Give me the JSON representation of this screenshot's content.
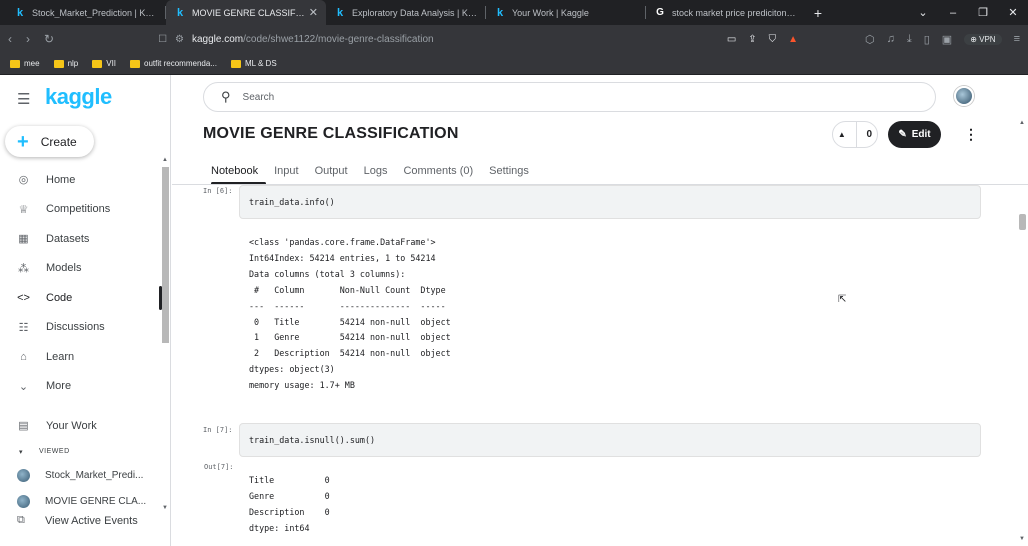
{
  "browser": {
    "tabs": [
      {
        "label": "Stock_Market_Prediction | Kaggle",
        "icon": "kaggle-icon",
        "active": false
      },
      {
        "label": "MOVIE GENRE CLASSIFICATION",
        "icon": "kaggle-icon",
        "active": true
      },
      {
        "label": "Exploratory Data Analysis | Kaggle",
        "icon": "kaggle-icon",
        "active": false
      },
      {
        "label": "Your Work | Kaggle",
        "icon": "kaggle-icon",
        "active": false
      },
      {
        "label": "stock market price prediciton - Goo",
        "icon": "google-icon",
        "active": false
      }
    ],
    "url_host": "kaggle.com",
    "url_path": "/code/shwe1122/movie-genre-classification",
    "vpn_label": "VPN",
    "bookmarks": [
      "mee",
      "nlp",
      "VII",
      "outfit recommenda...",
      "ML & DS"
    ]
  },
  "sidebar": {
    "logo": "kaggle",
    "create_label": "Create",
    "items": [
      {
        "label": "Home",
        "icon": "compass-icon"
      },
      {
        "label": "Competitions",
        "icon": "trophy-icon"
      },
      {
        "label": "Datasets",
        "icon": "table-icon"
      },
      {
        "label": "Models",
        "icon": "models-icon"
      },
      {
        "label": "Code",
        "icon": "code-icon"
      },
      {
        "label": "Discussions",
        "icon": "discussions-icon"
      },
      {
        "label": "Learn",
        "icon": "learn-icon"
      },
      {
        "label": "More",
        "icon": "chevron-down-icon"
      }
    ],
    "your_work_label": "Your Work",
    "viewed_label": "VIEWED",
    "viewed_items": [
      "Stock_Market_Predi...",
      "MOVIE GENRE CLA..."
    ],
    "view_active_events": "View Active Events"
  },
  "header": {
    "search_placeholder": "Search",
    "title": "MOVIE GENRE CLASSIFICATION",
    "vote_count": "0",
    "edit_label": "Edit",
    "tabs": [
      "Notebook",
      "Input",
      "Output",
      "Logs",
      "Comments (0)",
      "Settings"
    ]
  },
  "notebook": {
    "cell6_prompt": "In [6]:",
    "cell6_code": "train_data.info()",
    "cell6_output": "<class 'pandas.core.frame.DataFrame'>\nInt64Index: 54214 entries, 1 to 54214\nData columns (total 3 columns):\n #   Column       Non-Null Count  Dtype \n---  ------       --------------  ----- \n 0   Title        54214 non-null  object\n 1   Genre        54214 non-null  object\n 2   Description  54214 non-null  object\ndtypes: object(3)\nmemory usage: 1.7+ MB",
    "cell7_prompt": "In [7]:",
    "cell7_code": "train_data.isnull().sum()",
    "out7_prompt": "Out[7]:",
    "out7_output": "Title          0\nGenre          0\nDescription    0\ndtype: int64"
  },
  "colors": {
    "kaggle_blue": "#20beff",
    "chrome_dark": "#202124",
    "edit_button": "#202124"
  }
}
